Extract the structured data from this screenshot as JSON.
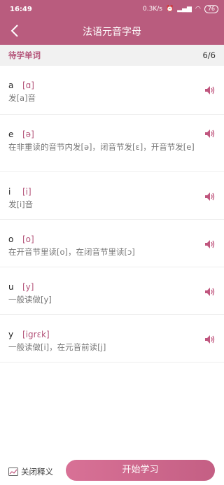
{
  "status_bar": {
    "time": "16:49",
    "speed": "0.3K/s",
    "battery": "76"
  },
  "header": {
    "title": "法语元音字母"
  },
  "subheader": {
    "label": "待学单词",
    "count": "6/6"
  },
  "items": [
    {
      "letter": "a",
      "phonetic": "[ɑ]",
      "desc": "发[a]音"
    },
    {
      "letter": "e",
      "phonetic": "[ə]",
      "desc": "在非重读的音节内发[ə]，闭音节发[ɛ]，开音节发[e]"
    },
    {
      "letter": "i",
      "phonetic": "[i]",
      "desc": "发[i]音"
    },
    {
      "letter": "o",
      "phonetic": "[o]",
      "desc": "在开音节里读[o]，在闭音节里读[ɔ]"
    },
    {
      "letter": "u",
      "phonetic": "[y]",
      "desc": "一般读做[y]"
    },
    {
      "letter": "y",
      "phonetic": "[igrɛk]",
      "desc": "一般读做[i]，在元音前读[j]"
    }
  ],
  "bottom": {
    "close_label": "关闭释义",
    "start_label": "开始学习"
  },
  "colors": {
    "accent": "#b95c7e",
    "button": "#d06b8f"
  },
  "icons": {
    "back": "back-arrow-icon",
    "speaker": "speaker-icon",
    "checkbox": "checkbox-icon"
  }
}
